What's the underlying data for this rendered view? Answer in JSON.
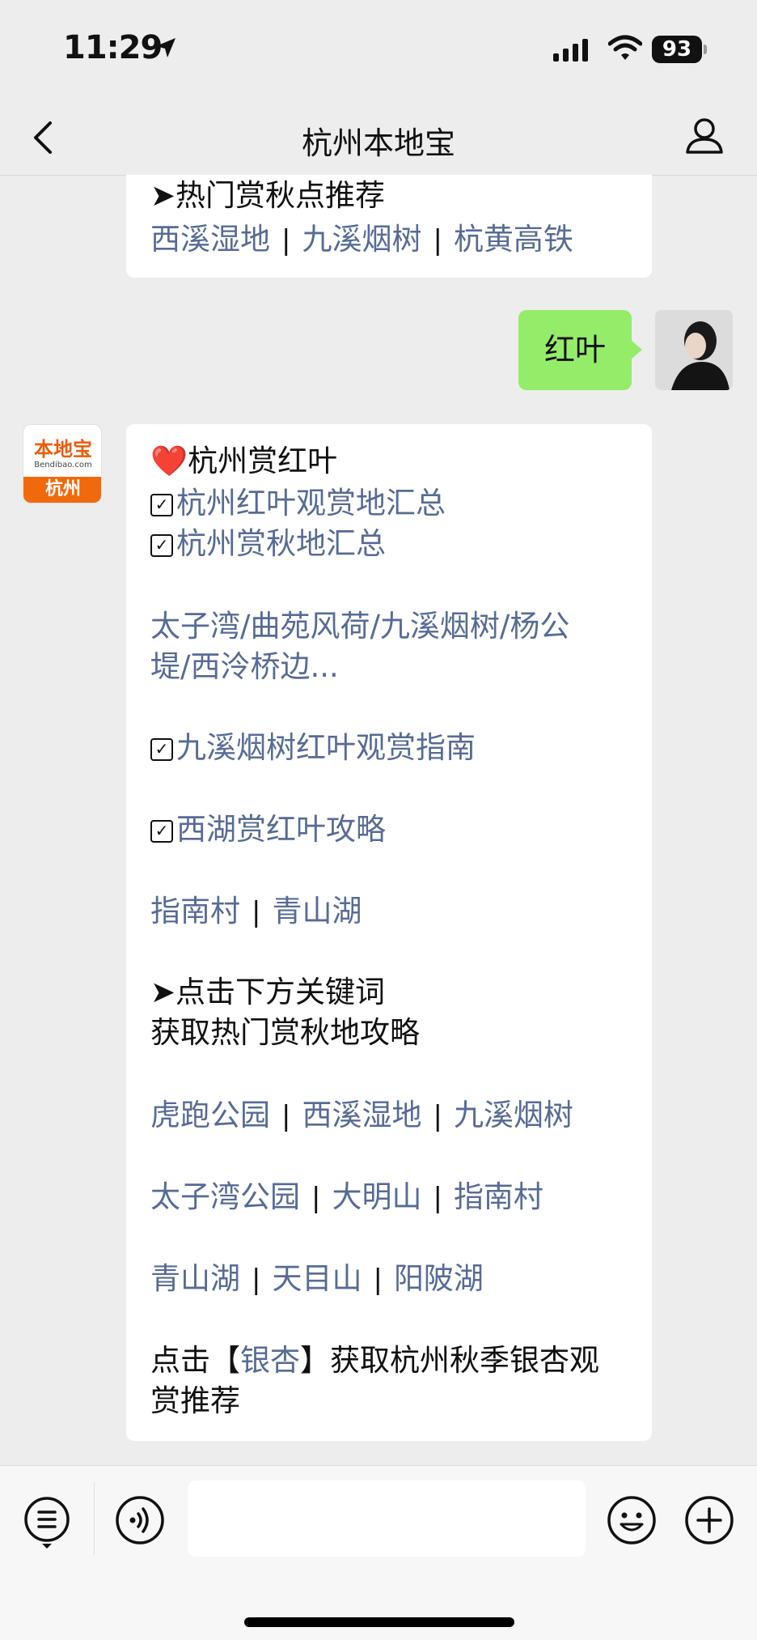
{
  "status_bar": {
    "time": "11:29",
    "battery": "93"
  },
  "header": {
    "title": "杭州本地宝"
  },
  "top_bubble": {
    "heading": "➤热门赏秋点推荐",
    "links": [
      "西溪湿地",
      "九溪烟树",
      "杭黄高铁"
    ]
  },
  "user_message": {
    "text": "红叶"
  },
  "sender_logo": {
    "brand": "本地宝",
    "url": "Bendibao.com",
    "city": "杭州"
  },
  "reply": {
    "heart_title": "❤️杭州赏红叶",
    "check_links": {
      "a": "杭州红叶观赏地汇总",
      "b": "杭州赏秋地汇总",
      "c": "九溪烟树红叶观赏指南",
      "d": "西湖赏红叶攻略"
    },
    "spots_line1": "太子湾/曲苑风荷/九溪烟树/杨公",
    "spots_line2": "堤/西泠桥边...",
    "row1": [
      "指南村",
      "青山湖"
    ],
    "keyword_heading": "➤点击下方关键词",
    "keyword_sub": "获取热门赏秋地攻略",
    "row2": [
      "虎跑公园",
      "西溪湿地",
      "九溪烟树"
    ],
    "row3": [
      "太子湾公园",
      "大明山",
      "指南村"
    ],
    "row4": [
      "青山湖",
      "天目山",
      "阳陂湖"
    ],
    "ginkgo_prefix": "点击【",
    "ginkgo_link": "银杏",
    "ginkgo_suffix": "】获取杭州秋季银杏观",
    "ginkgo_line2": "赏推荐"
  },
  "icons": {
    "back": "back-chevron-icon",
    "profile": "person-icon",
    "menu": "menu-list-icon",
    "voice": "voice-icon",
    "emoji": "emoji-icon",
    "plus": "plus-icon",
    "location": "location-arrow-icon"
  }
}
